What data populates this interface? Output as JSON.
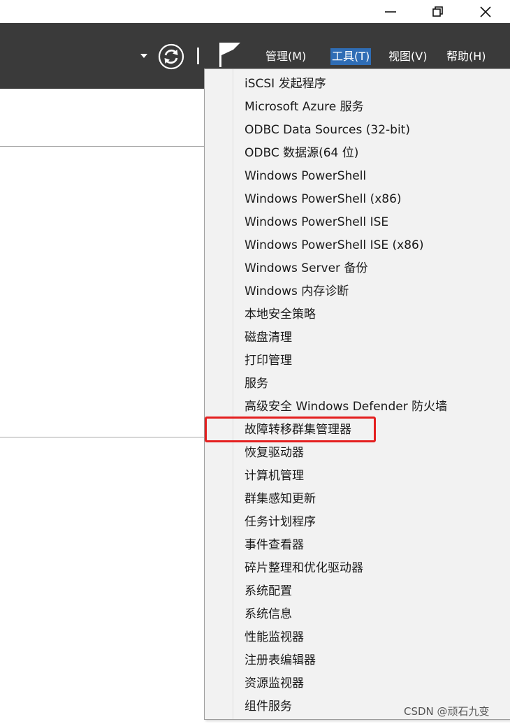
{
  "window_controls": {
    "minimize_icon": "minimize-icon",
    "maximize_icon": "restore-icon",
    "close_icon": "close-icon"
  },
  "header": {
    "refresh_icon": "refresh-icon",
    "flag_icon": "notifications-flag-icon",
    "menu": [
      {
        "label": "管理(M)",
        "active": false
      },
      {
        "label": "工具(T)",
        "active": true
      },
      {
        "label": "视图(V)",
        "active": false
      },
      {
        "label": "帮助(H)",
        "active": false
      }
    ]
  },
  "tools_menu": {
    "items": [
      "iSCSI 发起程序",
      "Microsoft Azure 服务",
      "ODBC Data Sources (32-bit)",
      "ODBC 数据源(64 位)",
      "Windows PowerShell",
      "Windows PowerShell (x86)",
      "Windows PowerShell ISE",
      "Windows PowerShell ISE (x86)",
      "Windows Server 备份",
      "Windows 内存诊断",
      "本地安全策略",
      "磁盘清理",
      "打印管理",
      "服务",
      "高级安全 Windows Defender 防火墙",
      "故障转移群集管理器",
      "恢复驱动器",
      "计算机管理",
      "群集感知更新",
      "任务计划程序",
      "事件查看器",
      "碎片整理和优化驱动器",
      "系统配置",
      "系统信息",
      "性能监视器",
      "注册表编辑器",
      "资源监视器",
      "组件服务"
    ],
    "highlighted_index": 15
  },
  "colors": {
    "header_bg": "#3a3a3a",
    "menu_active_bg": "#2f6db5",
    "highlight_border": "#e41f1f"
  },
  "watermark": "CSDN @顽石九变"
}
